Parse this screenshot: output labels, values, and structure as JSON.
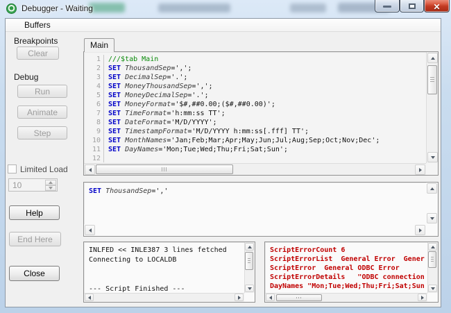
{
  "window": {
    "title": "Debugger - Waiting",
    "icon": "qlikview-logo",
    "controls": {
      "minimize": "minimize",
      "maximize": "maximize",
      "close": "close"
    }
  },
  "menu": {
    "buffers_label": "Buffers"
  },
  "sidebar": {
    "breakpoints_label": "Breakpoints",
    "clear_button": "Clear",
    "debug_label": "Debug",
    "run_button": "Run",
    "animate_button": "Animate",
    "step_button": "Step",
    "limited_load_label": "Limited Load",
    "limited_load_checked": false,
    "limited_load_value": "10",
    "help_button": "Help",
    "end_here_button": "End Here",
    "close_button": "Close"
  },
  "editor": {
    "tab_label": "Main",
    "lines": [
      {
        "num": "1",
        "tokens": [
          [
            "comment",
            "///$tab Main"
          ]
        ]
      },
      {
        "num": "2",
        "tokens": [
          [
            "kw",
            "SET"
          ],
          [
            "plain",
            " "
          ],
          [
            "var",
            "ThousandSep"
          ],
          [
            "plain",
            "=',';"
          ]
        ]
      },
      {
        "num": "3",
        "tokens": [
          [
            "kw",
            "SET"
          ],
          [
            "plain",
            " "
          ],
          [
            "var",
            "DecimalSep"
          ],
          [
            "plain",
            "='.';"
          ]
        ]
      },
      {
        "num": "4",
        "tokens": [
          [
            "kw",
            "SET"
          ],
          [
            "plain",
            " "
          ],
          [
            "var",
            "MoneyThousandSep"
          ],
          [
            "plain",
            "=',';"
          ]
        ]
      },
      {
        "num": "5",
        "tokens": [
          [
            "kw",
            "SET"
          ],
          [
            "plain",
            " "
          ],
          [
            "var",
            "MoneyDecimalSep"
          ],
          [
            "plain",
            "='.';"
          ]
        ]
      },
      {
        "num": "6",
        "tokens": [
          [
            "kw",
            "SET"
          ],
          [
            "plain",
            " "
          ],
          [
            "var",
            "MoneyFormat"
          ],
          [
            "plain",
            "='$#,##0.00;($#,##0.00)';"
          ]
        ]
      },
      {
        "num": "7",
        "tokens": [
          [
            "kw",
            "SET"
          ],
          [
            "plain",
            " "
          ],
          [
            "var",
            "TimeFormat"
          ],
          [
            "plain",
            "='h:mm:ss TT';"
          ]
        ]
      },
      {
        "num": "8",
        "tokens": [
          [
            "kw",
            "SET"
          ],
          [
            "plain",
            " "
          ],
          [
            "var",
            "DateFormat"
          ],
          [
            "plain",
            "='M/D/YYYY';"
          ]
        ]
      },
      {
        "num": "9",
        "tokens": [
          [
            "kw",
            "SET"
          ],
          [
            "plain",
            " "
          ],
          [
            "var",
            "TimestampFormat"
          ],
          [
            "plain",
            "='M/D/YYYY h:mm:ss[.fff] TT';"
          ]
        ]
      },
      {
        "num": "10",
        "tokens": [
          [
            "kw",
            "SET"
          ],
          [
            "plain",
            " "
          ],
          [
            "var",
            "MonthNames"
          ],
          [
            "plain",
            "='Jan;Feb;Mar;Apr;May;Jun;Jul;Aug;Sep;Oct;Nov;Dec';"
          ]
        ]
      },
      {
        "num": "11",
        "tokens": [
          [
            "kw",
            "SET"
          ],
          [
            "plain",
            " "
          ],
          [
            "var",
            "DayNames"
          ],
          [
            "plain",
            "='Mon;Tue;Wed;Thu;Fri;Sat;Sun';"
          ]
        ]
      },
      {
        "num": "12",
        "tokens": []
      }
    ]
  },
  "watch": {
    "tokens": [
      [
        "kw",
        "SET"
      ],
      [
        "plain",
        " "
      ],
      [
        "var",
        "ThousandSep"
      ],
      [
        "plain",
        "=','"
      ]
    ]
  },
  "status_output": {
    "lines": [
      "INLFED << INLE387 3 lines fetched",
      "Connecting to LOCALDB",
      "",
      "",
      "--- Script Finished ---"
    ]
  },
  "error_output": {
    "lines": [
      "ScriptErrorCount 6",
      "ScriptErrorList  General Error  Gener",
      "ScriptError  General ODBC Error",
      "ScriptErrorDetails   \"ODBC connection",
      "DayNames \"Mon;Tue;Wed;Thu;Fri;Sat;Sun"
    ]
  },
  "colors": {
    "error_text": "#c00000",
    "keyword": "#0000c8",
    "comment": "#0a8a0a",
    "close_button_red": "#c23a22",
    "dialog_bg": "#f0f0f0",
    "titlebar_glass": "#c9dcef"
  }
}
